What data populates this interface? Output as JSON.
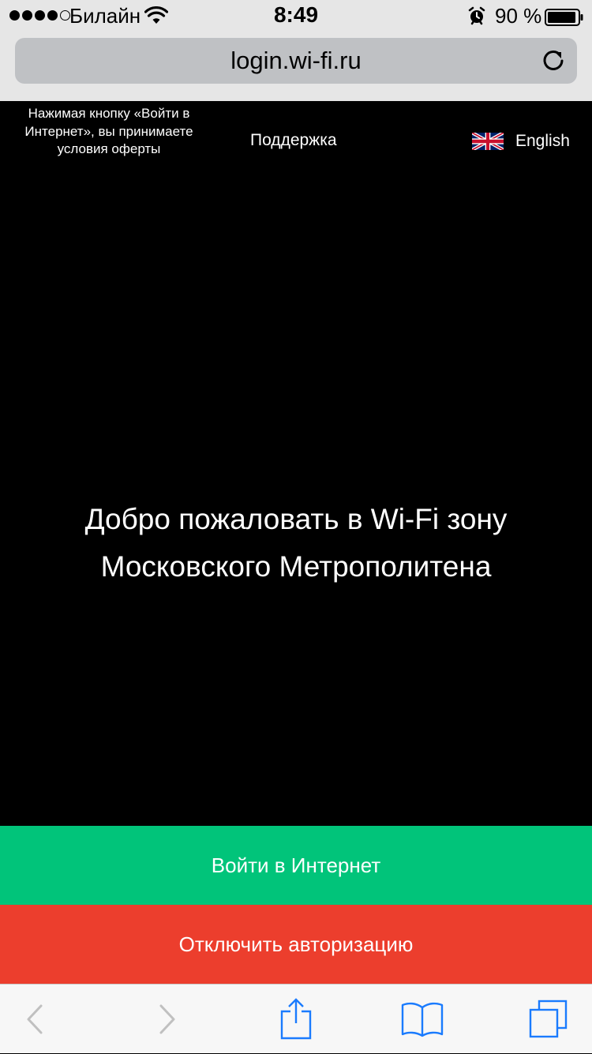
{
  "status_bar": {
    "carrier": "Билайн",
    "time": "8:49",
    "battery": "90 %",
    "signal_bars_filled": 4,
    "signal_bars_total": 5,
    "icons": [
      "wifi-icon",
      "alarm-icon",
      "battery-icon"
    ]
  },
  "address_bar": {
    "url": "login.wi-fi.ru",
    "reload_icon": "reload-icon"
  },
  "header": {
    "offer_text": "Нажимая кнопку «Войти в Интернет», вы принимаете условия оферты",
    "support_label": "Поддержка",
    "language_label": "English",
    "language_icon": "uk-flag-icon"
  },
  "main": {
    "welcome_line1": "Добро пожаловать в Wi-Fi зону",
    "welcome_line2": "Московского Метрополитена"
  },
  "actions": {
    "login_label": "Войти в Интернет",
    "disable_label": "Отключить авторизацию"
  },
  "toolbar": {
    "icons": [
      "back-icon",
      "forward-icon",
      "share-icon",
      "bookmarks-icon",
      "tabs-icon"
    ]
  },
  "colors": {
    "login_button": "#01c47a",
    "disable_button": "#ec3e2d",
    "page_background": "#000000",
    "toolbar_icon": "#1a7bfe",
    "toolbar_icon_disabled": "#c0c0c0"
  }
}
